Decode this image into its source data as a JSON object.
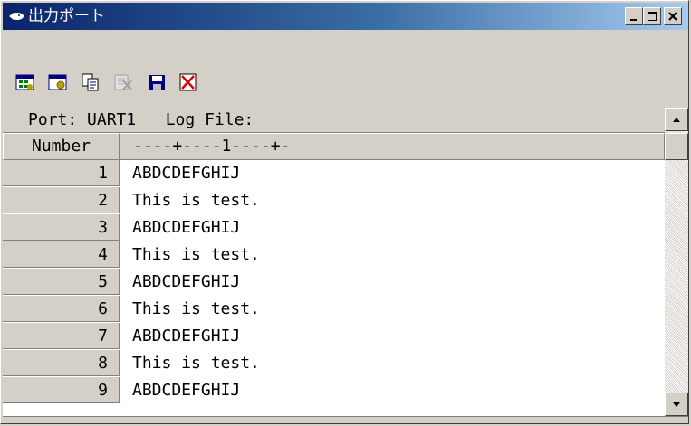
{
  "window": {
    "title": "出力ポート",
    "minimize_label": "minimize",
    "maximize_label": "maximize",
    "close_label": "close"
  },
  "toolbar": {
    "icons": [
      "settings-icon",
      "window-settings-icon",
      "copy-icon",
      "clear-icon",
      "save-icon",
      "close-log-icon"
    ]
  },
  "log": {
    "port_line": "Port: UART1   Log File:",
    "number_header": "Number",
    "ruler": "----+----1----+-",
    "rows": [
      {
        "number": "1",
        "text": "ABDCDEFGHIJ"
      },
      {
        "number": "2",
        "text": "This is test."
      },
      {
        "number": "3",
        "text": "ABDCDEFGHIJ"
      },
      {
        "number": "4",
        "text": "This is test."
      },
      {
        "number": "5",
        "text": "ABDCDEFGHIJ"
      },
      {
        "number": "6",
        "text": "This is test."
      },
      {
        "number": "7",
        "text": "ABDCDEFGHIJ"
      },
      {
        "number": "8",
        "text": "This is test."
      },
      {
        "number": "9",
        "text": "ABDCDEFGHIJ"
      }
    ]
  },
  "colors": {
    "title_gradient_start": "#0a246a",
    "title_gradient_end": "#a6caf0",
    "face": "#d4d0c8"
  }
}
